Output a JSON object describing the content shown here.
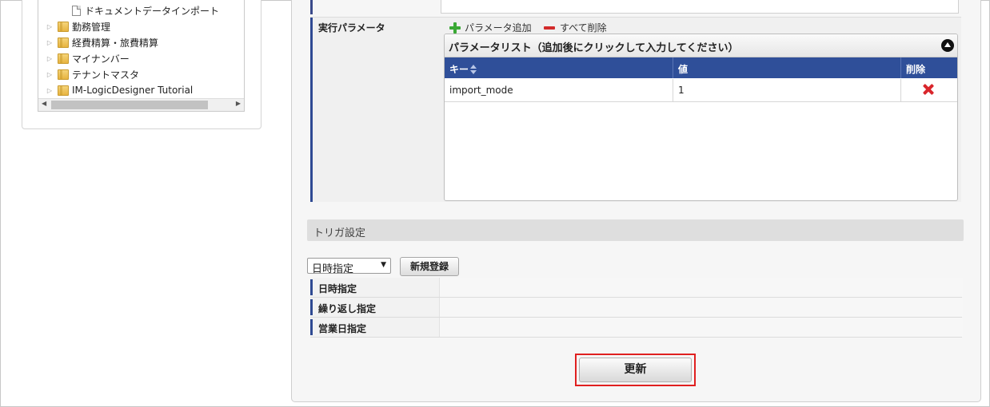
{
  "tree": {
    "items": [
      {
        "label": "ドキュメントデータインポート",
        "type": "document"
      },
      {
        "label": "勤務管理",
        "type": "folder"
      },
      {
        "label": "経費精算・旅費精算",
        "type": "folder"
      },
      {
        "label": "マイナンバー",
        "type": "folder"
      },
      {
        "label": "テナントマスタ",
        "type": "folder"
      },
      {
        "label": "IM-LogicDesigner Tutorial",
        "type": "folder"
      }
    ]
  },
  "params": {
    "label": "実行パラメータ",
    "add_label": "パラメータ追加",
    "delete_all_label": "すべて削除",
    "list_title": "パラメータリスト（追加後にクリックして入力してください）",
    "columns": {
      "key": "キー",
      "value": "値",
      "delete": "削除"
    },
    "rows": [
      {
        "key": "import_mode",
        "value": "1"
      }
    ]
  },
  "trigger": {
    "section_title": "トリガ設定",
    "select_value": "日時指定",
    "register_label": "新規登録",
    "rows": [
      {
        "label": "日時指定"
      },
      {
        "label": "繰り返し指定"
      },
      {
        "label": "営業日指定"
      }
    ]
  },
  "footer": {
    "update_label": "更新"
  },
  "colors": {
    "accent_blue": "#2f4f99",
    "delete_red": "#d9262c",
    "add_green": "#3aa935",
    "highlight_red": "#e02020"
  }
}
